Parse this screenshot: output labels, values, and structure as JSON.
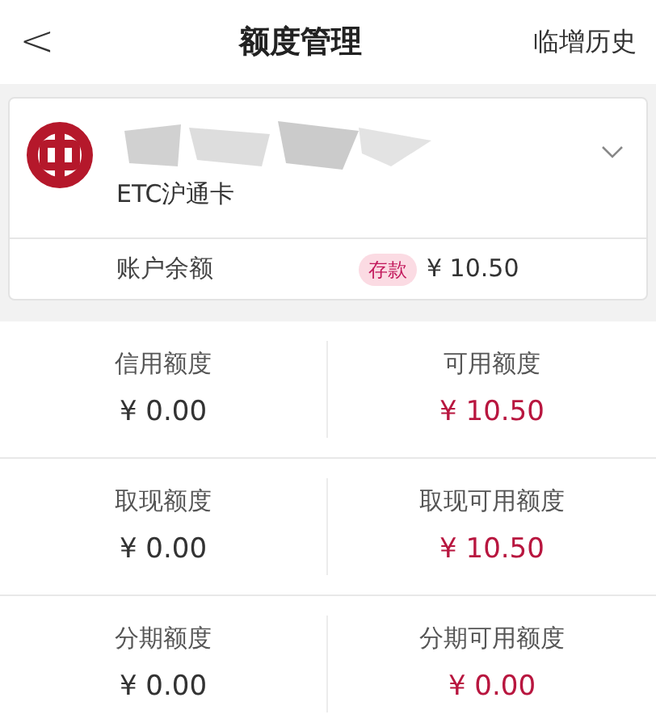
{
  "header": {
    "back": "<",
    "title": "额度管理",
    "action": "临增历史"
  },
  "card": {
    "name": "ETC沪通卡",
    "expanded": false,
    "balance_label": "账户余额",
    "balance_tag": "存款",
    "balance": "¥ 10.50"
  },
  "limits": [
    {
      "label": "信用额度",
      "amount": "¥ 0.00",
      "highlighted": false
    },
    {
      "label": "可用额度",
      "amount": "¥ 10.50",
      "highlighted": true
    },
    {
      "label": "取现额度",
      "amount": "¥ 0.00",
      "highlighted": false
    },
    {
      "label": "取现可用额度",
      "amount": "¥ 10.50",
      "highlighted": true
    },
    {
      "label": "分期额度",
      "amount": "¥ 0.00",
      "highlighted": false
    },
    {
      "label": "分期可用额度",
      "amount": "¥ 0.00",
      "highlighted": true
    }
  ]
}
